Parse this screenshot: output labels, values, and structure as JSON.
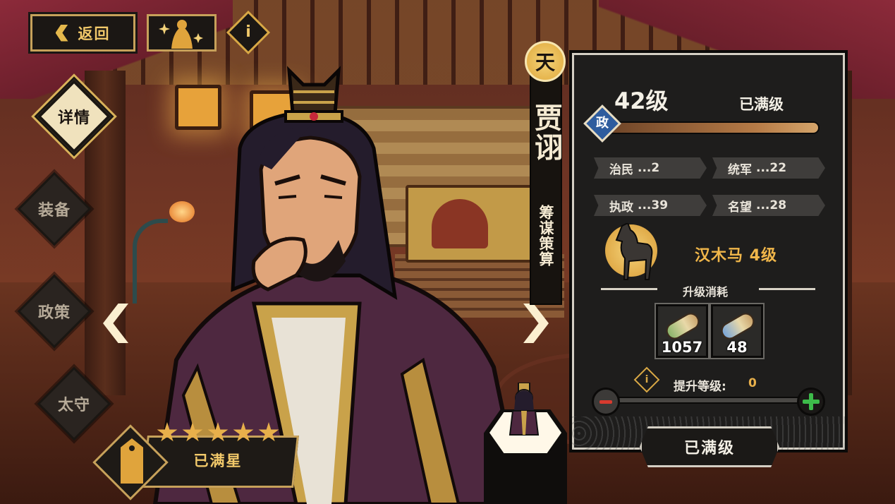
{
  "topbar": {
    "back_label": "返回",
    "info_icon_text": "i"
  },
  "sidebar": {
    "items": [
      {
        "label": "详情",
        "active": true
      },
      {
        "label": "装备",
        "active": false
      },
      {
        "label": "政策",
        "active": false
      },
      {
        "label": "太守",
        "active": false
      }
    ]
  },
  "hero": {
    "rank_seal": "天",
    "name": "贾诩",
    "title": "筹谋策算",
    "star_count": 5,
    "star_label": "已满星"
  },
  "panel": {
    "level": "42级",
    "level_status": "已满级",
    "attribute_badge": "政",
    "xp_progress": 1.0,
    "stats": [
      {
        "name": "治民",
        "value": "...2"
      },
      {
        "name": "统军",
        "value": "...22"
      },
      {
        "name": "执政",
        "value": "...39"
      },
      {
        "name": "名望",
        "value": "...28"
      }
    ],
    "item": "汉木马 4级",
    "cost_title": "升级消耗",
    "costs": [
      {
        "icon": "green-scroll-icon",
        "amount": "1057"
      },
      {
        "icon": "blue-scroll-icon",
        "amount": "48"
      }
    ],
    "raise_label": "提升等级:",
    "raise_value": "0",
    "info_icon_text": "i",
    "max_button_label": "已满级"
  },
  "colors": {
    "gold": "#e8b04b",
    "panel_bg": "#1e1d1c",
    "plus_green": "#3dbb4a",
    "minus_red": "#d83a2e",
    "attribute_blue": "#2e5c9e"
  }
}
